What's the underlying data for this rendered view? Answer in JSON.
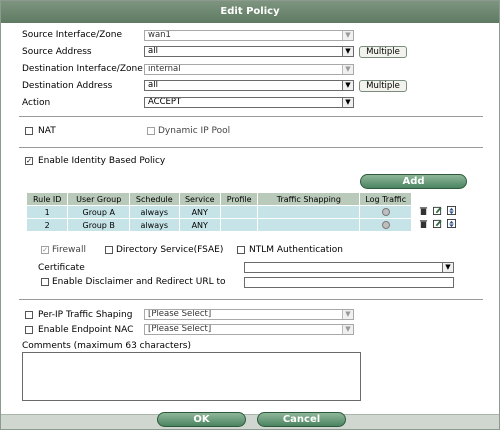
{
  "title": "Edit Policy",
  "form": {
    "source_interface": {
      "label": "Source Interface/Zone",
      "value": "wan1"
    },
    "source_address": {
      "label": "Source Address",
      "value": "all",
      "button": "Multiple"
    },
    "destination_interface": {
      "label": "Destination Interface/Zone",
      "value": "internal"
    },
    "destination_address": {
      "label": "Destination Address",
      "value": "all",
      "button": "Multiple"
    },
    "action": {
      "label": "Action",
      "value": "ACCEPT"
    }
  },
  "nat": {
    "label": "NAT",
    "checked": false
  },
  "dynamic_ip_pool": {
    "label": "Dynamic IP Pool",
    "checked": false
  },
  "identity_policy": {
    "label": "Enable Identity Based Policy",
    "checked": true
  },
  "add_button": "Add",
  "table": {
    "headers": [
      "Rule ID",
      "User Group",
      "Schedule",
      "Service",
      "Profile",
      "Traffic Shapping",
      "Log Traffic"
    ],
    "rows": [
      {
        "rule_id": "1",
        "user_group": "Group A",
        "schedule": "always",
        "service": "ANY",
        "profile": "",
        "traffic_shaping": ""
      },
      {
        "rule_id": "2",
        "user_group": "Group B",
        "schedule": "always",
        "service": "ANY",
        "profile": "",
        "traffic_shaping": ""
      }
    ]
  },
  "auth": {
    "firewall": "Firewall",
    "directory_service": "Directory Service(FSAE)",
    "ntlm": "NTLM Authentication"
  },
  "certificate": {
    "label": "Certificate",
    "value": ""
  },
  "disclaimer": {
    "label": "Enable Disclaimer and Redirect URL to",
    "value": ""
  },
  "per_ip_shaping": {
    "label": "Per-IP Traffic Shaping",
    "value": "[Please Select]"
  },
  "endpoint_nac": {
    "label": "Enable Endpoint NAC",
    "value": "[Please Select]"
  },
  "comments": {
    "label": "Comments (maximum 63 characters)",
    "value": ""
  },
  "buttons": {
    "ok": "OK",
    "cancel": "Cancel"
  },
  "icons": {
    "delete": "trash-icon",
    "edit": "edit-icon",
    "move": "move-icon"
  },
  "colors": {
    "titlebar": "#6b866d",
    "table_header": "#b9c9ba",
    "table_row": "#c6e4e8",
    "button": "#5d9270"
  }
}
